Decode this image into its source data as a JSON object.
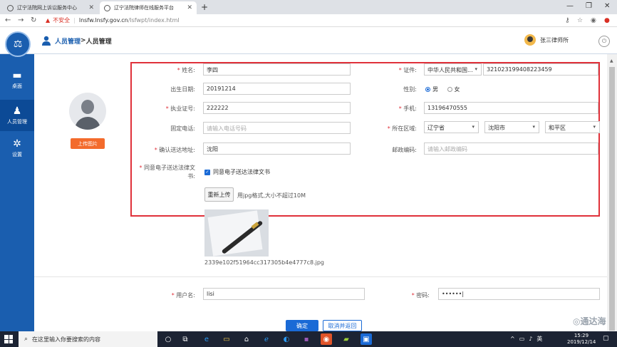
{
  "browser": {
    "tabs": [
      {
        "title": "辽宁法院网上诉讼服务中心"
      },
      {
        "title": "辽宁法院律师在线服务平台"
      }
    ],
    "new_tab": "+",
    "security_warning": "不安全",
    "url_host": "lnsfw.lnsfy.gov.cn",
    "url_path": "/lsfwpt/index.html"
  },
  "header": {
    "breadcrumb_root": "人员管理",
    "breadcrumb_sep": " > ",
    "breadcrumb_current": "人员管理",
    "user_name": "张三律师所"
  },
  "sidebar": {
    "items": [
      {
        "label": "桌面",
        "icon": "desktop-icon"
      },
      {
        "label": "人员管理",
        "icon": "person-icon"
      },
      {
        "label": "设置",
        "icon": "gear-icon"
      }
    ]
  },
  "form": {
    "upload_photo_label": "上传图片",
    "name": {
      "label": "姓名:",
      "value": "李四"
    },
    "id_type": {
      "label": "证件:",
      "value": "中华人民共和国..."
    },
    "id_number": {
      "value": "321023199408223459"
    },
    "birthdate": {
      "label": "出生日期:",
      "value": "20191214"
    },
    "gender": {
      "label": "性别:",
      "options": [
        "男",
        "女"
      ],
      "selected": "男"
    },
    "license": {
      "label": "执业证号:",
      "value": "222222"
    },
    "mobile": {
      "label": "手机:",
      "value": "13196470555"
    },
    "landline": {
      "label": "固定电话:",
      "placeholder": "请输入电话号码"
    },
    "region": {
      "label": "所在区域:",
      "province": "辽宁省",
      "city": "沈阳市",
      "district": "和平区"
    },
    "address": {
      "label": "确认送达地址:",
      "value": "沈阳"
    },
    "postcode": {
      "label": "邮政编码:",
      "placeholder": "请输入邮政编码"
    },
    "consent": {
      "label_line1": "同意电子送达法律文",
      "label_line2": "书:",
      "checkbox_label": "同意电子送达法律文书",
      "checked": true
    },
    "reupload_label": "重新上传",
    "upload_hint": "用jpg格式,大小不超过10M",
    "file_name": "2339e102f51964cc317305b4e4777c8.jpg",
    "username": {
      "label": "用户名:",
      "value": "lisi"
    },
    "password": {
      "label": "密码:",
      "value": "••••••"
    },
    "confirm_button": "确定",
    "cancel_button": "取消并返回"
  },
  "watermark": "◎通达海",
  "taskbar": {
    "search_placeholder": "在这里输入你要搜索的内容",
    "tray_text": "英",
    "time": "15:29",
    "date": "2019/12/14"
  },
  "colors": {
    "brand_blue": "#1a5eaf",
    "highlight_red": "#e0313a",
    "upload_orange": "#f36b2c",
    "button_blue": "#1a6ad6"
  }
}
